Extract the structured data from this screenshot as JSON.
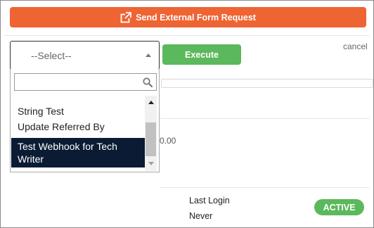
{
  "header": {
    "send_form_label": "Send External Form Request",
    "send_form_icon": "external-link-icon"
  },
  "action_bar": {
    "select_value": "--Select--",
    "execute_label": "Execute",
    "cancel_label": "cancel"
  },
  "dropdown": {
    "search_value": "",
    "search_icon": "search-icon",
    "options": [
      {
        "label": "String Test",
        "selected": false
      },
      {
        "label": "Update Referred By",
        "selected": false
      },
      {
        "label": "Test Webhook for Tech Writer",
        "selected": true
      }
    ]
  },
  "background": {
    "amount_fragment": "0.00",
    "fragment_c": "c"
  },
  "user_info": {
    "last_login_label": "Last Login",
    "last_login_value": "Never",
    "status": "ACTIVE"
  },
  "colors": {
    "send_button": "#ee6433",
    "execute_button": "#5cb85c",
    "selected_option": "#0a1b33",
    "status_badge": "#5cb85c"
  }
}
